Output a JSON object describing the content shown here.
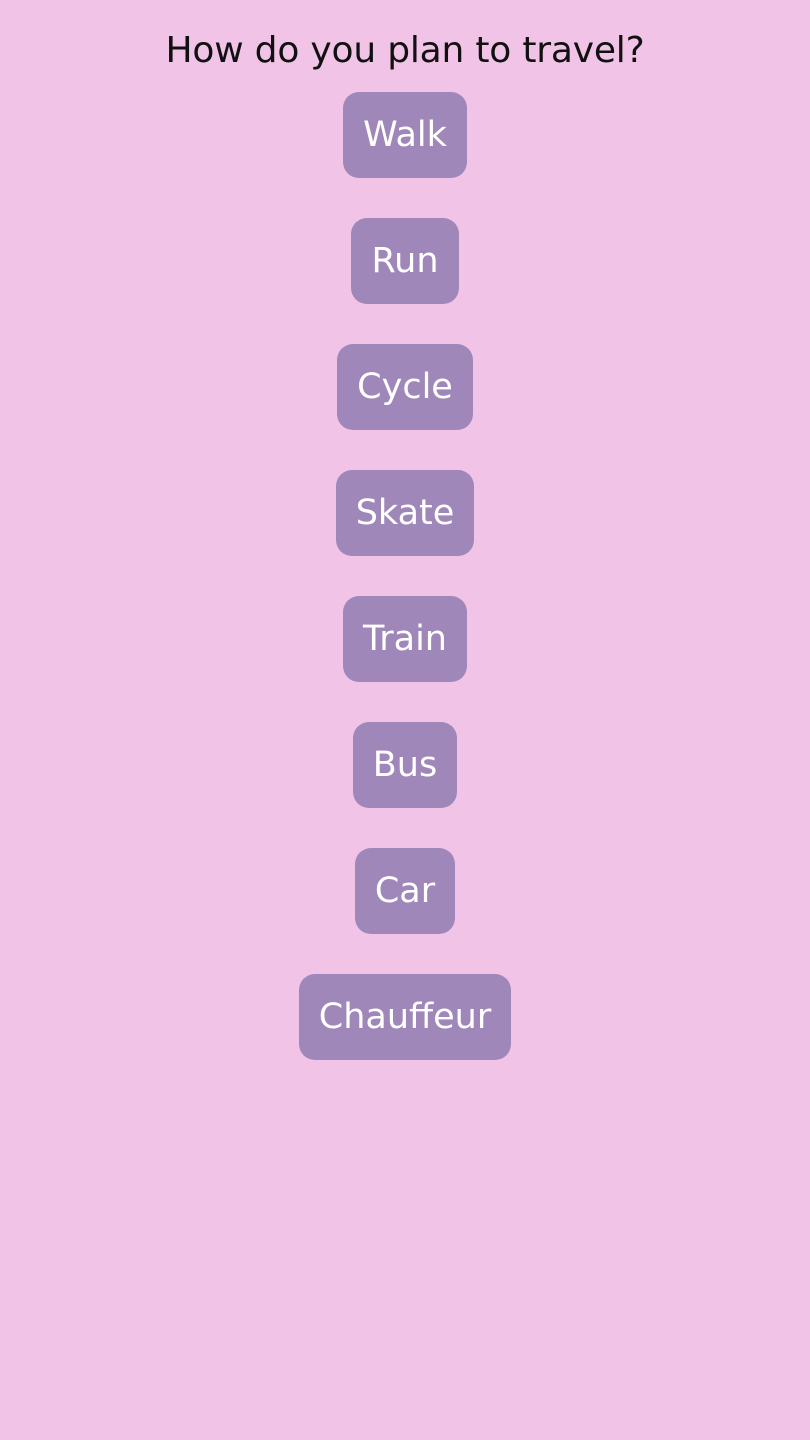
{
  "question": "How do you plan to travel?",
  "options": [
    {
      "label": "Walk"
    },
    {
      "label": "Run"
    },
    {
      "label": "Cycle"
    },
    {
      "label": "Skate"
    },
    {
      "label": "Train"
    },
    {
      "label": "Bus"
    },
    {
      "label": "Car"
    },
    {
      "label": "Chauffeur"
    }
  ],
  "colors": {
    "background": "#f1c3e7",
    "button": "#9f88b9",
    "button_text": "#ffffff",
    "question_text": "#111111"
  }
}
